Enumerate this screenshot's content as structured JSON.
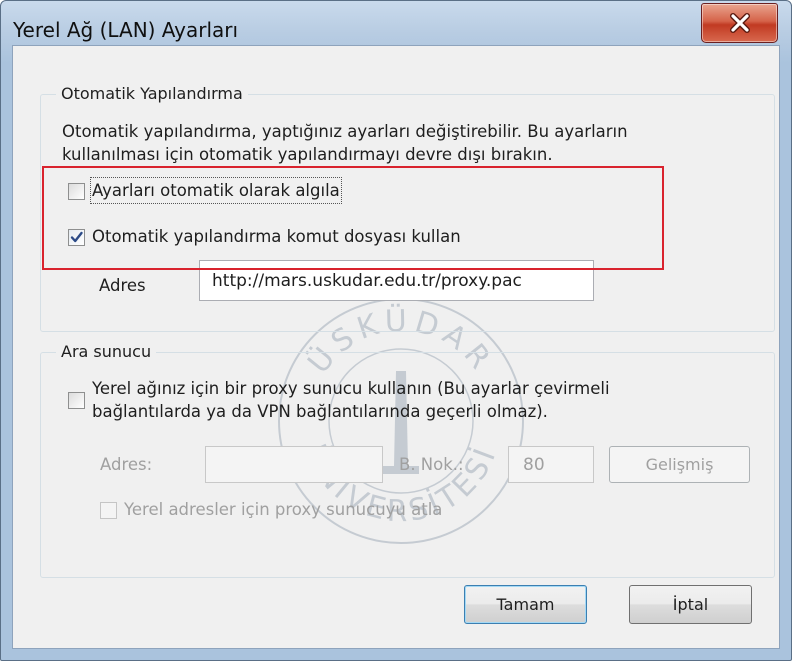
{
  "window": {
    "title": "Yerel Ağ (LAN) Ayarları",
    "close_glyph": "x"
  },
  "auto_config": {
    "legend": "Otomatik Yapılandırma",
    "description_line1": "Otomatik yapılandırma, yaptığınız ayarları değiştirebilir. Bu ayarların",
    "description_line2": "kullanılması için otomatik yapılandırmayı devre dışı bırakın.",
    "detect": {
      "label": "Ayarları otomatik olarak algıla",
      "checked": false
    },
    "script": {
      "label": "Otomatik yapılandırma komut dosyası kullan",
      "checked": true
    },
    "address_label": "Adres",
    "address_value": "http://mars.uskudar.edu.tr/proxy.pac"
  },
  "proxy": {
    "legend": "Ara sunucu",
    "use_proxy_line1": "Yerel ağınız için bir proxy sunucu kullanın (Bu ayarlar çevirmeli",
    "use_proxy_line2": "bağlantılarda ya da VPN bağlantılarında geçerli olmaz).",
    "address_label": "Adres:",
    "address_value": "",
    "port_label": "B. Nok.:",
    "port_value": "80",
    "advanced_label": "Gelişmiş",
    "bypass_label": "Yerel adresler için proxy sunucuyu atla"
  },
  "buttons": {
    "ok": "Tamam",
    "cancel": "İptal"
  },
  "watermark": {
    "text_top": "ÜSKÜDAR",
    "text_bottom": "ÜNİVERSİTESİ"
  },
  "colors": {
    "highlight": "#d9232e",
    "close": "#c13a22"
  }
}
